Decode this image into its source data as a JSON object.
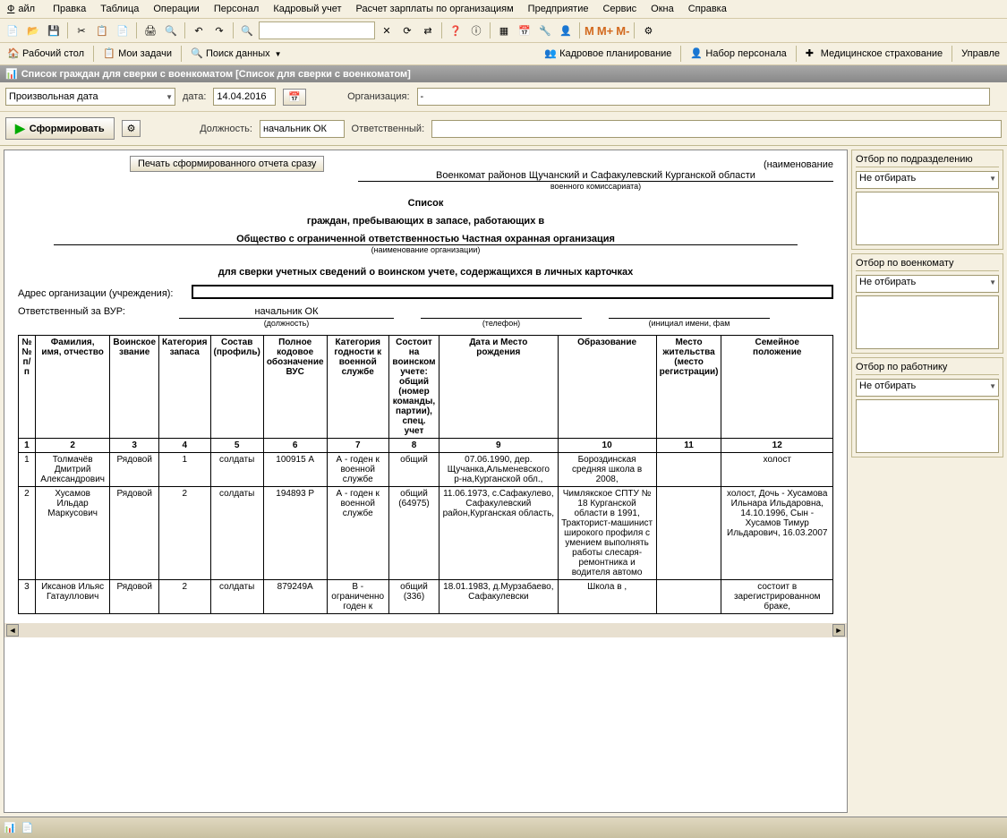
{
  "menu": {
    "file": "Файл",
    "edit": "Правка",
    "table": "Таблица",
    "ops": "Операции",
    "personnel": "Персонал",
    "hr": "Кадровый учет",
    "payroll": "Расчет зарплаты по организациям",
    "enterprise": "Предприятие",
    "service": "Сервис",
    "windows": "Окна",
    "help": "Справка"
  },
  "nav": {
    "desktop": "Рабочий стол",
    "tasks": "Мои задачи",
    "search": "Поиск данных",
    "planning": "Кадровое планирование",
    "recruit": "Набор персонала",
    "medical": "Медицинское страхование",
    "manage": "Управле"
  },
  "title": "Список граждан для сверки с военкоматом [Список для сверки с военкоматом]",
  "filters": {
    "date_mode": "Произвольная дата",
    "date_lbl": "дата:",
    "date_val": "14.04.2016",
    "org_lbl": "Организация:",
    "org_val": "-",
    "form_btn": "Сформировать",
    "post_lbl": "Должность:",
    "post_val": "начальник ОК",
    "resp_lbl": "Ответственный:",
    "resp_val": ""
  },
  "print_btn": "Печать сформированного отчета сразу",
  "report": {
    "naim": "(наименование",
    "komissariat": "Военкомат районов Щучанский и Сафакулевский Курганской области",
    "komissariat_sub": "военного комиссариата)",
    "t1": "Список",
    "t2": "граждан, пребывающих в запасе, работающих в",
    "org": "Общество с ограниченной ответственностью Частная охранная организация",
    "org_sub": "(наименование организации)",
    "t3": "для сверки учетных сведений о воинском учете, содержащихся в личных карточках",
    "addr_lbl": "Адрес организации (учреждения):",
    "resp_lbl": "Ответственный за ВУР:",
    "resp_post": "начальник ОК",
    "resp_post_sub": "(должность)",
    "resp_tel": "(телефон)",
    "resp_name": "(инициал имени, фам"
  },
  "headers": [
    "№ №\nп/п",
    "Фамилия,\nимя, отчество",
    "Воинское\nзвание",
    "Категория\nзапаса",
    "Состав\n(профиль)",
    "Полное\nкодовое\nобозначение\nВУС",
    "Категория\nгодности к\nвоенной\nслужбе",
    "Состоит на\nвоинском\nучете:\nобщий\n(номер\nкоманды,\nпартии),\nспец. учет",
    "Дата и Место\nрождения",
    "Образование",
    "Место\nжительства\n(место\nрегистрации)",
    "Семейное\nположение"
  ],
  "nums": [
    "1",
    "2",
    "3",
    "4",
    "5",
    "6",
    "7",
    "8",
    "9",
    "10",
    "11",
    "12"
  ],
  "rows": [
    {
      "n": "1",
      "fio": "Толмачёв Дмитрий Александрович",
      "rank": "Рядовой",
      "cat": "1",
      "comp": "солдаты",
      "vus": "100915 А",
      "fit": "А - годен к военной службе",
      "reg": "общий",
      "birth": "07.06.1990, дер. Щучанка,Альменевского р-на,Курганской обл.,",
      "edu": "Бороздинская средняя школа в 2008,",
      "addr": "",
      "fam": "холост"
    },
    {
      "n": "2",
      "fio": "Хусамов Ильдар Маркусович",
      "rank": "Рядовой",
      "cat": "2",
      "comp": "солдаты",
      "vus": "194893 Р",
      "fit": "А - годен к военной службе",
      "reg": "общий (64975)",
      "birth": "11.06.1973, с.Сафакулево, Сафакулевский район,Курганская область,",
      "edu": "Чимлякское СПТУ № 18 Курганской области в 1991, Тракторист-машинист широкого профиля с умением выполнять работы слесаря-ремонтника и водителя автомо",
      "addr": "",
      "fam": "холост, Дочь - Хусамова Ильнара Ильдаровна, 14.10.1996, Сын - Хусамов Тимур Ильдарович, 16.03.2007"
    },
    {
      "n": "3",
      "fio": "Иксанов Ильяс Гатауллович",
      "rank": "Рядовой",
      "cat": "2",
      "comp": "солдаты",
      "vus": "879249А",
      "fit": "В - ограниченно годен к",
      "reg": "общий (336)",
      "birth": "18.01.1983, д.Мурзабаево, Сафакулевски",
      "edu": "Школа в ,",
      "addr": "",
      "fam": "состоит в зарегистрированном браке,"
    }
  ],
  "side": {
    "f1": "Отбор по подразделению",
    "f2": "Отбор по военкомату",
    "f3": "Отбор по работнику",
    "no_sel": "Не отбирать"
  },
  "m": {
    "m": "M",
    "mp": "M+",
    "mm": "M-"
  }
}
